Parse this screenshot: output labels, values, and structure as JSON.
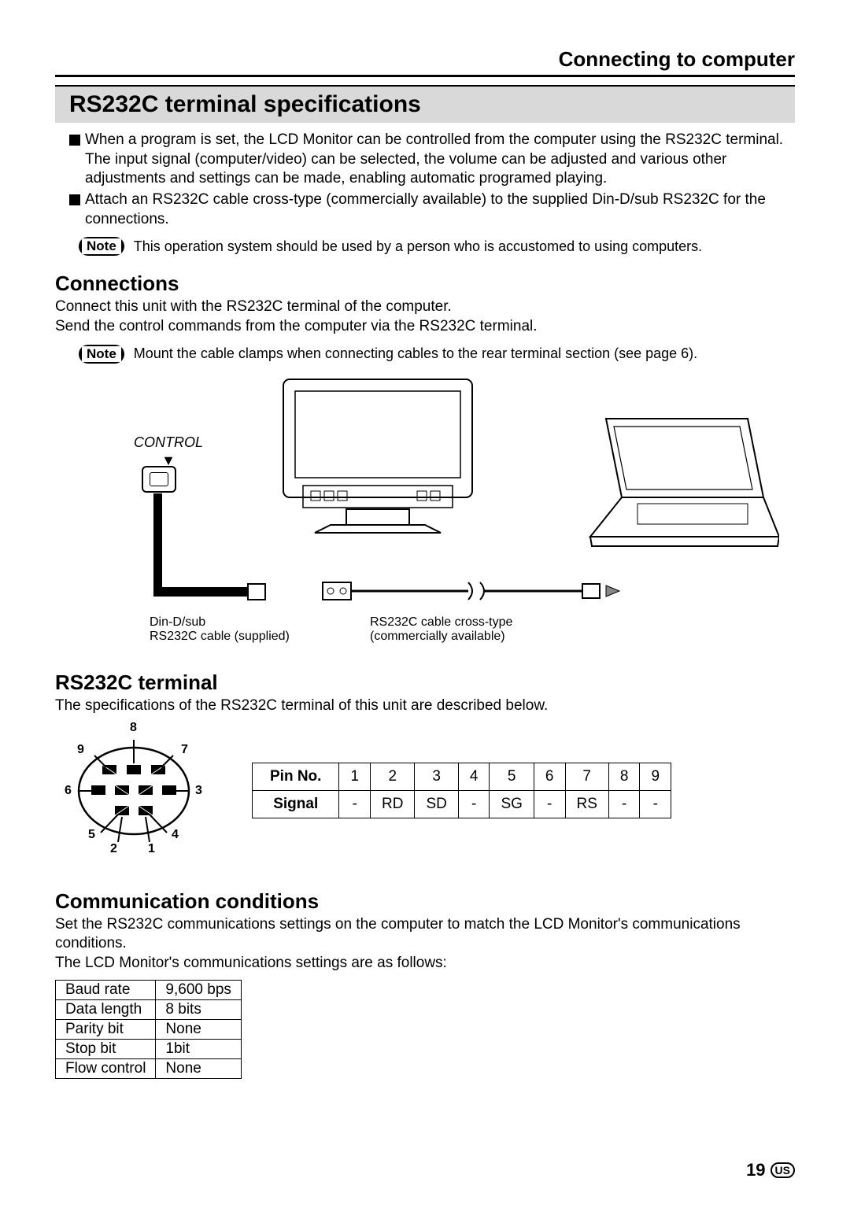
{
  "header": {
    "title": "Connecting to computer"
  },
  "section_title": "RS232C terminal specifications",
  "intro": {
    "bullet1": "When a program is set, the LCD Monitor can be controlled from the computer using the RS232C terminal.  The input signal (computer/video) can be selected, the volume can be adjusted and various other adjustments and settings can be made, enabling automatic programed playing.",
    "bullet2": "Attach an RS232C cable cross-type (commercially available) to the supplied Din-D/sub RS232C for the connections."
  },
  "note1": {
    "label": "Note",
    "text": "This operation system should be used by a person who is accustomed to using computers."
  },
  "connections": {
    "heading": "Connections",
    "text": "Connect this unit with the RS232C terminal of the computer.\nSend the control commands from the computer via the RS232C terminal."
  },
  "note2": {
    "label": "Note",
    "text": "Mount the cable clamps when connecting cables to the rear terminal section (see page 6)."
  },
  "diagram": {
    "control_label": "CONTROL",
    "cable1_l1": "Din-D/sub",
    "cable1_l2": "RS232C cable (supplied)",
    "cable2_l1": "RS232C cable cross-type",
    "cable2_l2": "(commercially available)"
  },
  "rs232c_terminal": {
    "heading": "RS232C terminal",
    "text": "The specifications of the RS232C terminal of this unit are described below."
  },
  "pin_labels": [
    "1",
    "2",
    "3",
    "4",
    "5",
    "6",
    "7",
    "8",
    "9"
  ],
  "pin_table": {
    "row1_label": "Pin No.",
    "row1": [
      "1",
      "2",
      "3",
      "4",
      "5",
      "6",
      "7",
      "8",
      "9"
    ],
    "row2_label": "Signal",
    "row2": [
      "-",
      "RD",
      "SD",
      "-",
      "SG",
      "-",
      "RS",
      "-",
      "-"
    ]
  },
  "comm": {
    "heading": "Communication conditions",
    "text": "Set the RS232C communications settings on the computer to match the LCD Monitor's communications conditions.\nThe LCD Monitor's communications settings are as follows:",
    "rows": [
      [
        "Baud rate",
        "9,600 bps"
      ],
      [
        "Data length",
        "8 bits"
      ],
      [
        "Parity bit",
        "None"
      ],
      [
        "Stop bit",
        "1bit"
      ],
      [
        "Flow control",
        "None"
      ]
    ]
  },
  "page_number": "19",
  "region_code": "US"
}
